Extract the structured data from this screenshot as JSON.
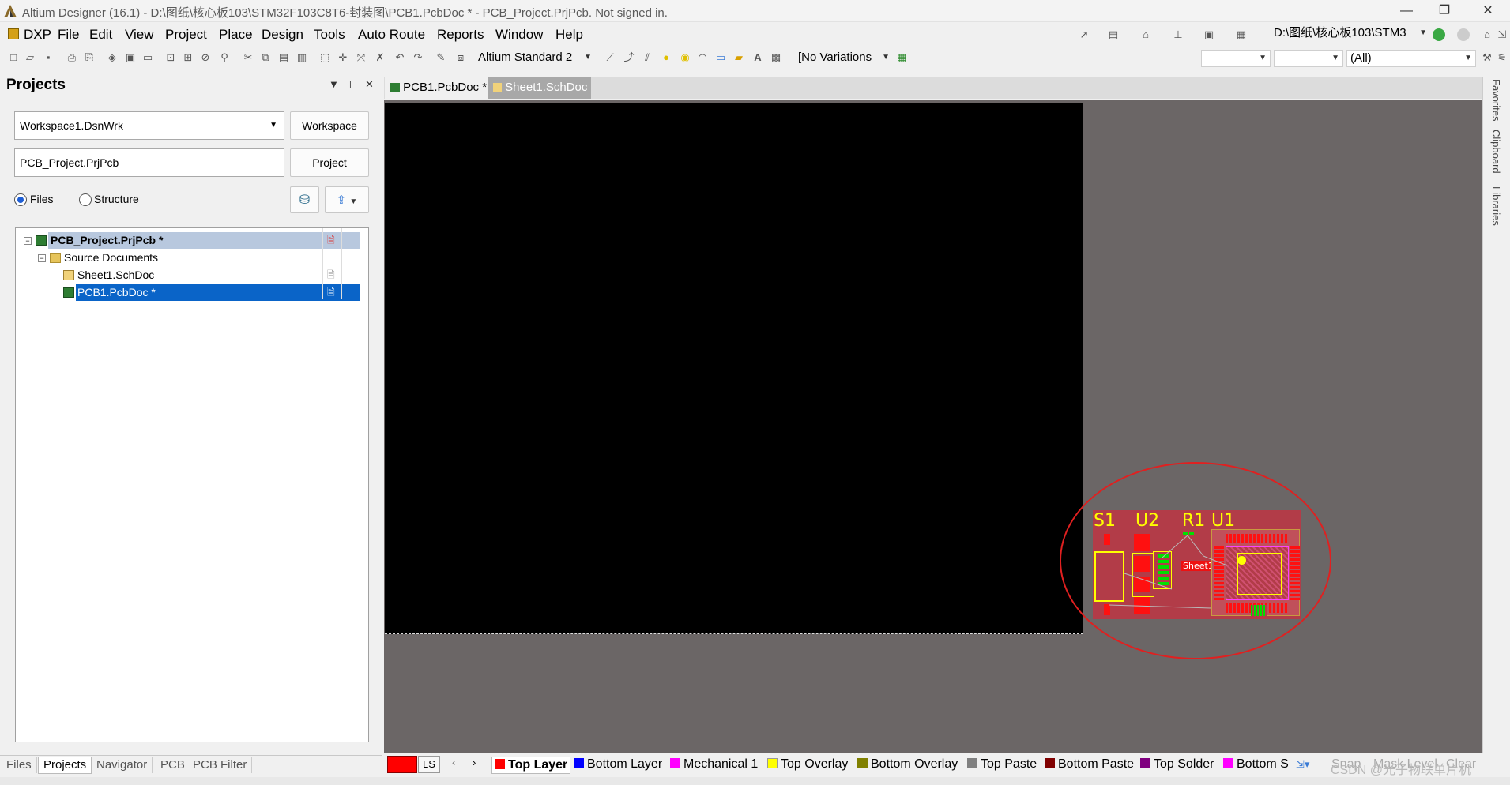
{
  "window": {
    "title": "Altium Designer (16.1) - D:\\图纸\\核心板103\\STM32F103C8T6-封装图\\PCB1.PcbDoc * - PCB_Project.PrjPcb. Not signed in.",
    "minimize": "—",
    "restore": "❐",
    "close": "✕"
  },
  "menu": [
    "DXP",
    "File",
    "Edit",
    "View",
    "Project",
    "Place",
    "Design",
    "Tools",
    "Auto Route",
    "Reports",
    "Window",
    "Help"
  ],
  "toolbar": {
    "standard_dropdown": "Altium Standard 2",
    "variations_dropdown": "[No Variations",
    "path_dropdown": "D:\\图纸\\核心板103\\STM3",
    "filter_dropdown": "(All)"
  },
  "projects_panel": {
    "title": "Projects",
    "workspace_value": "Workspace1.DsnWrk",
    "workspace_button": "Workspace",
    "project_value": "PCB_Project.PrjPcb",
    "project_button": "Project",
    "radio_files": "Files",
    "radio_structure": "Structure",
    "view_selected": "Files",
    "tree": {
      "project": "PCB_Project.PrjPcb *",
      "folder": "Source Documents",
      "docs": [
        "Sheet1.SchDoc",
        "PCB1.PcbDoc *"
      ]
    },
    "bottom_tabs": [
      "Files",
      "Projects",
      "Navigator",
      "PCB",
      "PCB Filter"
    ],
    "active_tab": "Projects"
  },
  "doc_tabs": [
    "PCB1.PcbDoc *",
    "Sheet1.SchDoc"
  ],
  "side_tabs": [
    "Favorites",
    "Clipboard",
    "Libraries"
  ],
  "pcb": {
    "designators": [
      "S1",
      "U2",
      "R1",
      "U1"
    ],
    "room_label": "Sheet1"
  },
  "layers": {
    "current_color": "#ff0000",
    "ls_label": "LS",
    "items": [
      {
        "name": "Top Layer",
        "color": "#ff0000",
        "active": true
      },
      {
        "name": "Bottom Layer",
        "color": "#0000ff"
      },
      {
        "name": "Mechanical 1",
        "color": "#ff00ff"
      },
      {
        "name": "Top Overlay",
        "color": "#ffff00"
      },
      {
        "name": "Bottom Overlay",
        "color": "#808000"
      },
      {
        "name": "Top Paste",
        "color": "#808080"
      },
      {
        "name": "Bottom Paste",
        "color": "#800000"
      },
      {
        "name": "Top Solder",
        "color": "#800080"
      },
      {
        "name": "Bottom S",
        "color": "#ff00ff"
      }
    ],
    "snap": "Snap",
    "mask_level": "Mask Level",
    "clear": "Clear"
  },
  "watermark": "CSDN @光子物联单片机"
}
